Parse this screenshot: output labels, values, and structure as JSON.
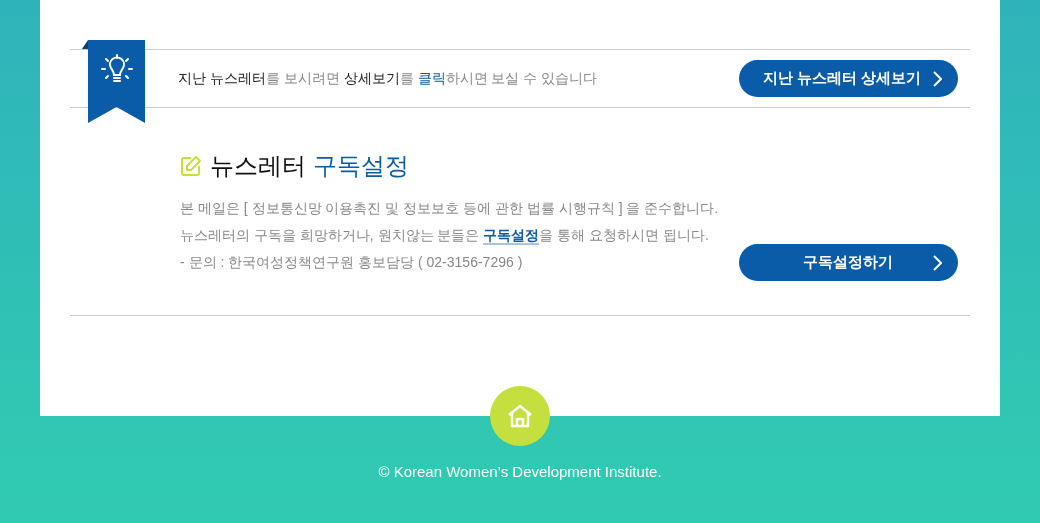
{
  "archive": {
    "intro": [
      {
        "text": "지난 뉴스레터",
        "kind": "strong"
      },
      {
        "text": "를 보시려면 ",
        "kind": "muted"
      },
      {
        "text": "상세보기",
        "kind": "strong"
      },
      {
        "text": "를 ",
        "kind": "muted"
      },
      {
        "text": "클릭",
        "kind": "accent"
      },
      {
        "text": "하시면 보실 수 있습니다",
        "kind": "muted"
      }
    ],
    "button": "지난 뉴스레터 상세보기"
  },
  "subscription": {
    "title": "뉴스레터",
    "title_accent": "구독설정",
    "notice": "본 메일은 [ 정보통신망 이용촉진 및 정보보호 등에 관한 법률 시행규칙 ] 을 준수합니다.",
    "request": [
      {
        "text": "뉴스레터의 구독을 희망하거나, 원치않는 분들은 ",
        "kind": "plain"
      },
      {
        "text": "구독설정",
        "kind": "link"
      },
      {
        "text": "을 통해 요청하시면 됩니다.",
        "kind": "plain"
      }
    ],
    "contact": "- 문의 : 한국여성정책연구원 홍보담당 ( 02-3156-7296 )",
    "button": "구독설정하기"
  },
  "footer": {
    "copyright": "© Korean Women’s Development Institute."
  }
}
